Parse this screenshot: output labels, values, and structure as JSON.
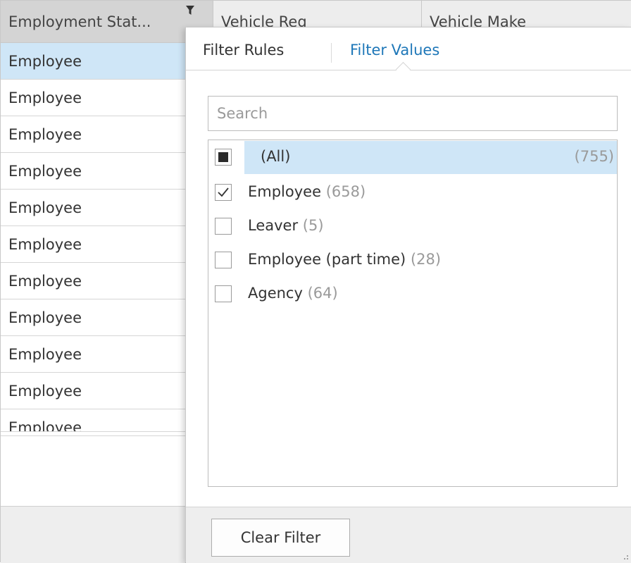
{
  "grid": {
    "columns": [
      "Employment Stat...",
      "Vehicle Reg",
      "Vehicle Make"
    ],
    "rows": [
      "Employee",
      "Employee",
      "Employee",
      "Employee",
      "Employee",
      "Employee",
      "Employee",
      "Employee",
      "Employee",
      "Employee",
      "Employee"
    ],
    "selected_row_index": 0
  },
  "filter_popup": {
    "tabs": {
      "rules": "Filter Rules",
      "values": "Filter Values",
      "active": "values"
    },
    "search": {
      "placeholder": "Search",
      "value": ""
    },
    "all_item": {
      "label": "(All)",
      "count": "(755)",
      "state": "partial"
    },
    "items": [
      {
        "label": "Employee",
        "count": "(658)",
        "checked": true
      },
      {
        "label": "Leaver",
        "count": "(5)",
        "checked": false
      },
      {
        "label": "Employee (part time)",
        "count": "(28)",
        "checked": false
      },
      {
        "label": "Agency",
        "count": "(64)",
        "checked": false
      }
    ],
    "clear_button": "Clear Filter"
  },
  "colors": {
    "accent": "#1e77b8",
    "selection": "#cfe6f7",
    "header_active": "#d4d4d4"
  },
  "icons": {
    "header_filter": "filter-funnel-icon",
    "check": "checkmark-icon",
    "resize": "resize-grip-icon"
  }
}
